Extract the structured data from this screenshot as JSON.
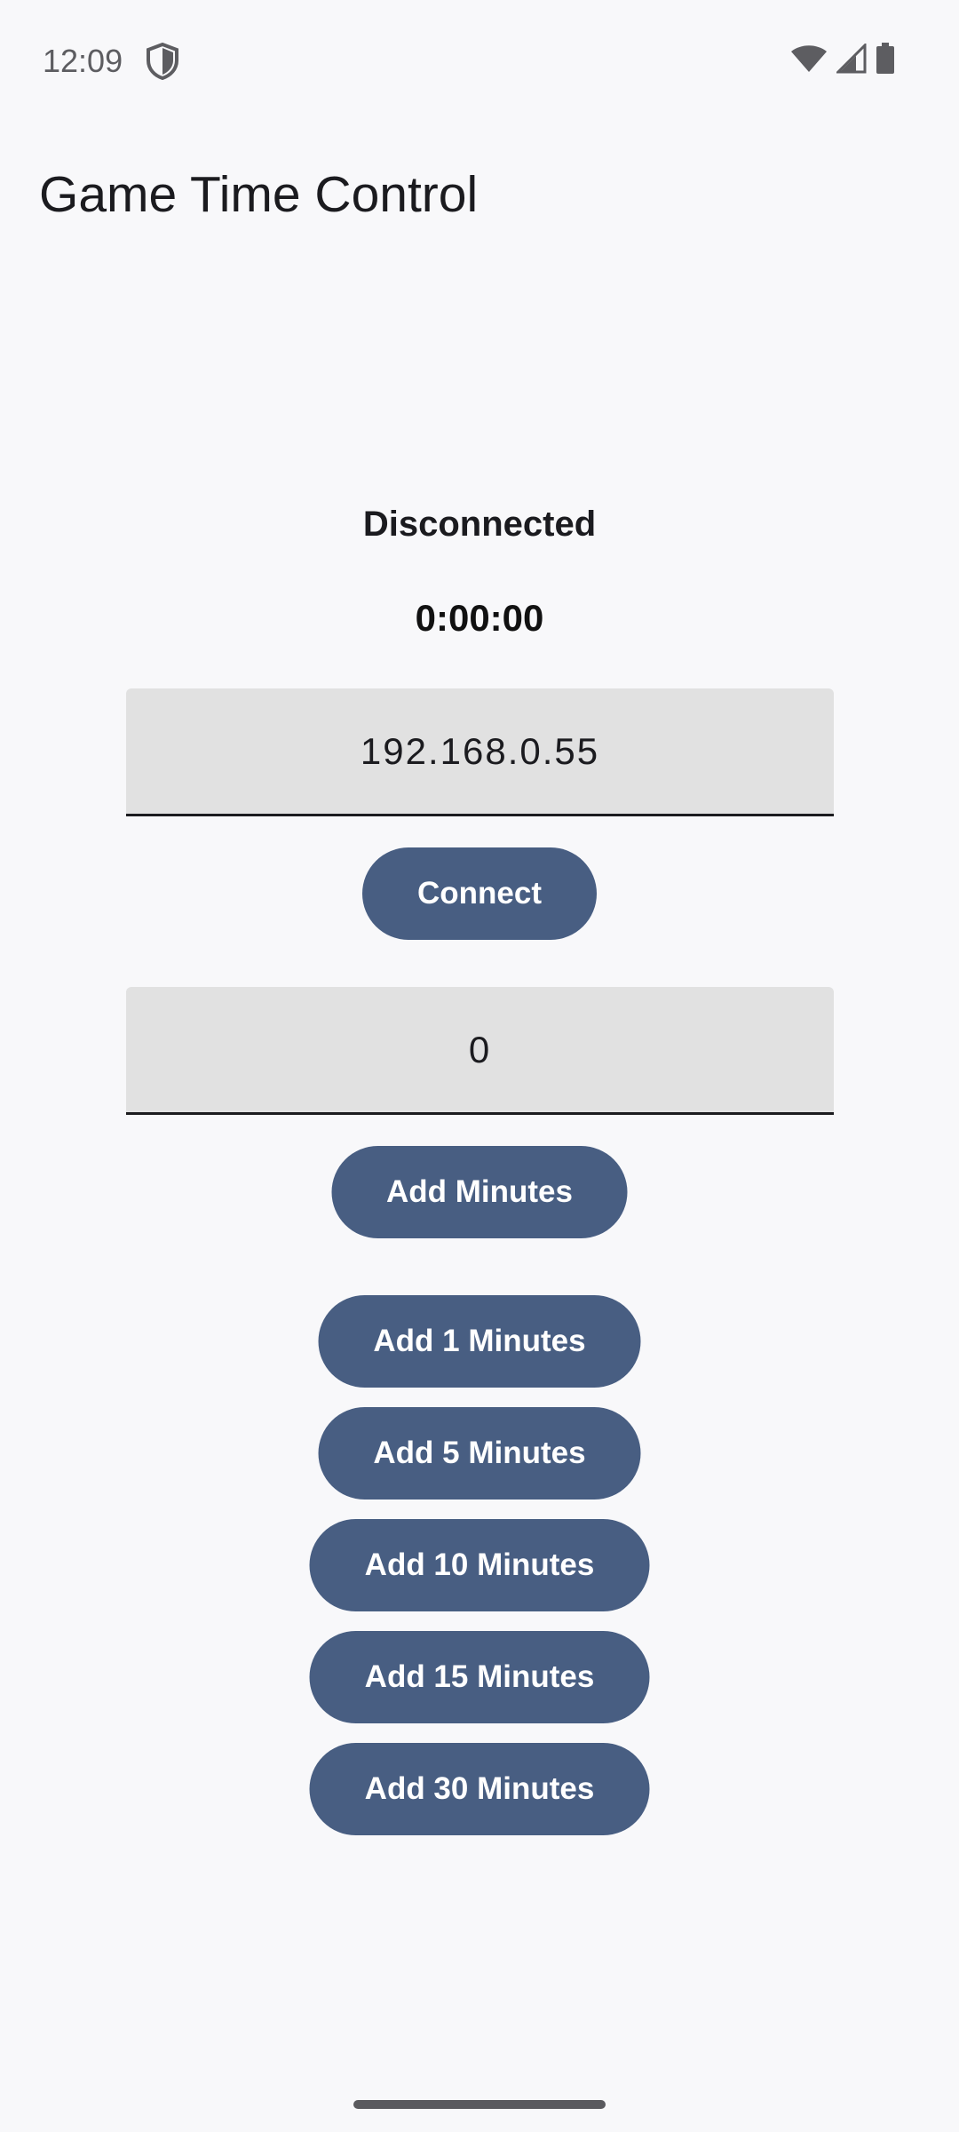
{
  "status_bar": {
    "time": "12:09",
    "icons": [
      "shield-icon",
      "wifi-icon",
      "cellular-signal-icon",
      "battery-icon"
    ]
  },
  "app": {
    "title": "Game Time Control"
  },
  "connection": {
    "status": "Disconnected",
    "timer": "0:00:00",
    "ip_value": "192.168.0.55",
    "connect_label": "Connect"
  },
  "minutes": {
    "value": "0",
    "add_label": "Add Minutes"
  },
  "quick_add": [
    {
      "label": "Add 1 Minutes"
    },
    {
      "label": "Add 5 Minutes"
    },
    {
      "label": "Add 10 Minutes"
    },
    {
      "label": "Add 15 Minutes"
    },
    {
      "label": "Add 30 Minutes"
    }
  ],
  "colors": {
    "background": "#f8f8fa",
    "button": "#485e82",
    "button_text": "#ffffff",
    "field_background": "#e1e1e1"
  }
}
